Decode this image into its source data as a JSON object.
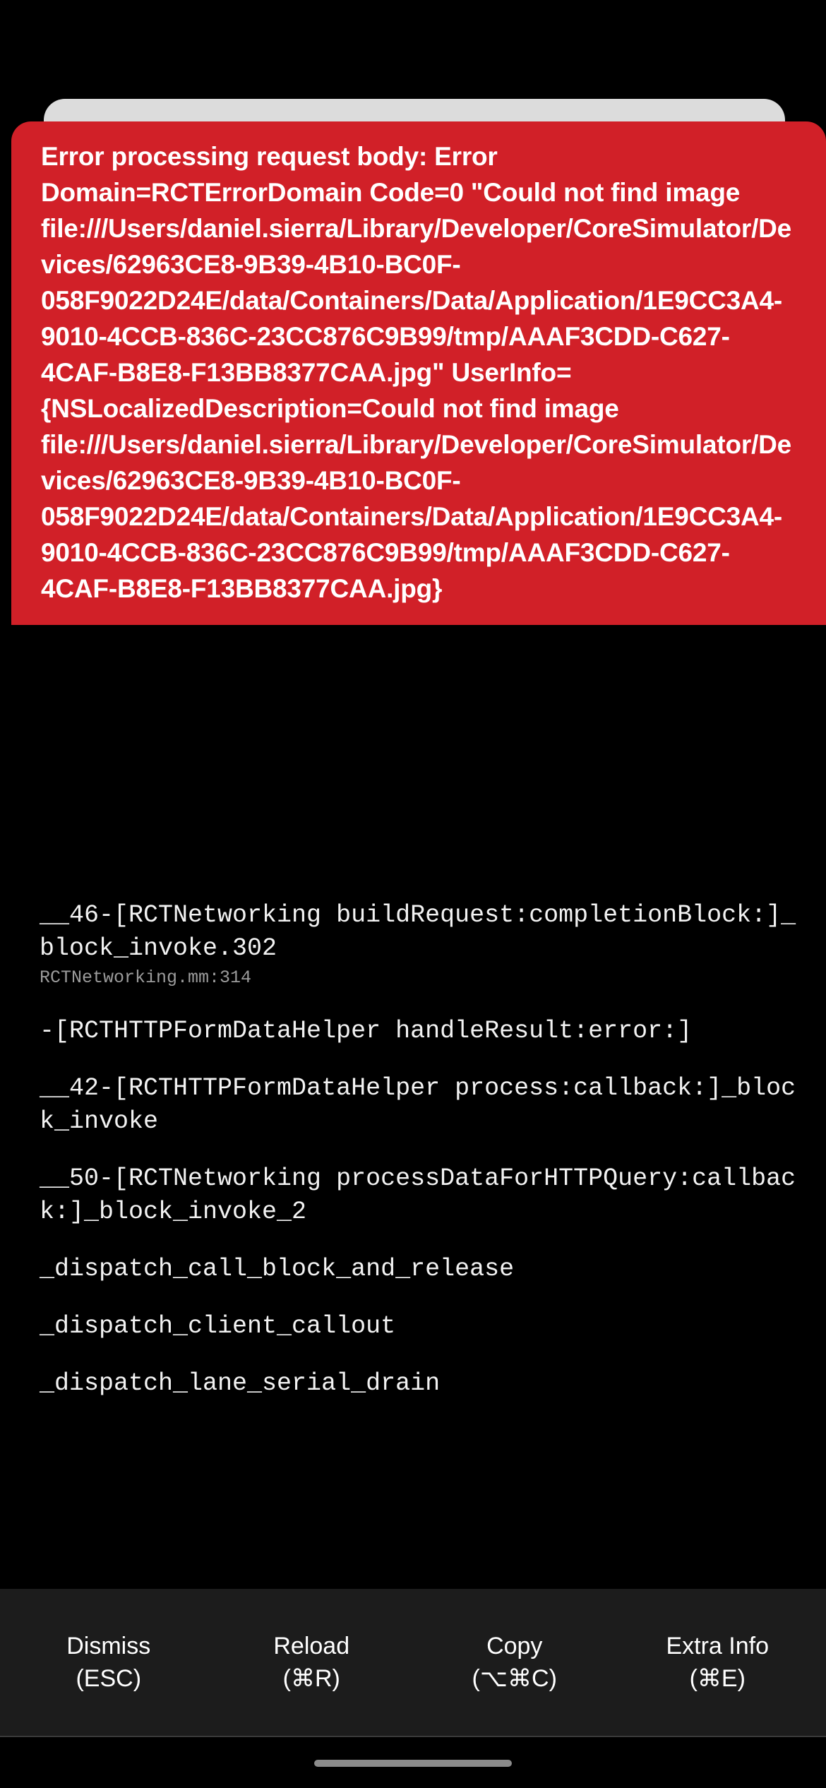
{
  "redbox": {
    "message": "Error processing request body: Error Domain=RCTErrorDomain Code=0 \"Could not find image file:///Users/daniel.sierra/Library/Developer/CoreSimulator/Devices/62963CE8-9B39-4B10-BC0F-058F9022D24E/data/Containers/Data/Application/1E9CC3A4-9010-4CCB-836C-23CC876C9B99/tmp/AAAF3CDD-C627-4CAF-B8E8-F13BB8377CAA.jpg\" UserInfo={NSLocalizedDescription=Could not find image file:///Users/daniel.sierra/Library/Developer/CoreSimulator/Devices/62963CE8-9B39-4B10-BC0F-058F9022D24E/data/Containers/Data/Application/1E9CC3A4-9010-4CCB-836C-23CC876C9B99/tmp/AAAF3CDD-C627-4CAF-B8E8-F13BB8377CAA.jpg}",
    "background_color": "#D12028",
    "text_color": "#FFFFFF"
  },
  "stack": {
    "frames": [
      {
        "title": "__46-[RCTNetworking buildRequest:completionBlock:]_block_invoke.302",
        "source": "RCTNetworking.mm:314"
      },
      {
        "title": "-[RCTHTTPFormDataHelper handleResult:error:]",
        "source": ""
      },
      {
        "title": "__42-[RCTHTTPFormDataHelper process:callback:]_block_invoke",
        "source": ""
      },
      {
        "title": "__50-[RCTNetworking processDataForHTTPQuery:callback:]_block_invoke_2",
        "source": ""
      },
      {
        "title": "_dispatch_call_block_and_release",
        "source": ""
      },
      {
        "title": "_dispatch_client_callout",
        "source": ""
      },
      {
        "title": "_dispatch_lane_serial_drain",
        "source": ""
      }
    ]
  },
  "toolbar": {
    "background_color": "#1C1C1C",
    "buttons": [
      {
        "label": "Dismiss",
        "shortcut": "(ESC)"
      },
      {
        "label": "Reload",
        "shortcut": "(⌘R)"
      },
      {
        "label": "Copy",
        "shortcut": "(⌥⌘C)"
      },
      {
        "label": "Extra Info",
        "shortcut": "(⌘E)"
      }
    ]
  }
}
